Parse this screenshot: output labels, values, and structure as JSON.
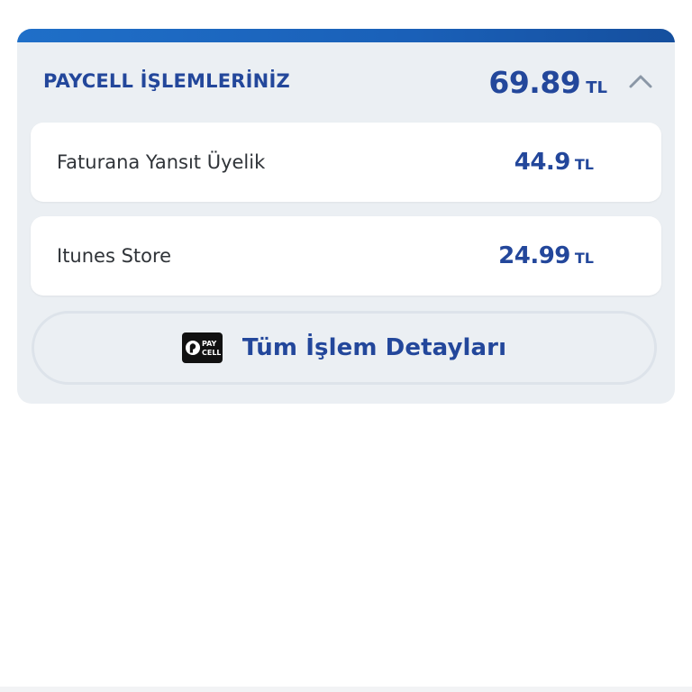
{
  "paycell_card": {
    "title": "PAYCELL İŞLEMLERİNİZ",
    "total_amount": "69.89",
    "currency": "TL",
    "collapse_icon": "chevron-up-icon",
    "items": [
      {
        "label": "Faturana Yansıt Üyelik",
        "amount": "44.9",
        "currency": "TL"
      },
      {
        "label": "Itunes Store",
        "amount": "24.99",
        "currency": "TL"
      }
    ],
    "details_button": {
      "label": "Tüm İşlem Detayları",
      "logo_icon": "paycell-logo-icon",
      "logo_text_top": "PAY",
      "logo_text_bottom": "CELL"
    }
  },
  "colors": {
    "accent": "#23479b",
    "top_bar": "#1a60b8",
    "card_bg": "#ebeff3",
    "row_bg": "#ffffff",
    "text_dark": "#2f3338"
  }
}
